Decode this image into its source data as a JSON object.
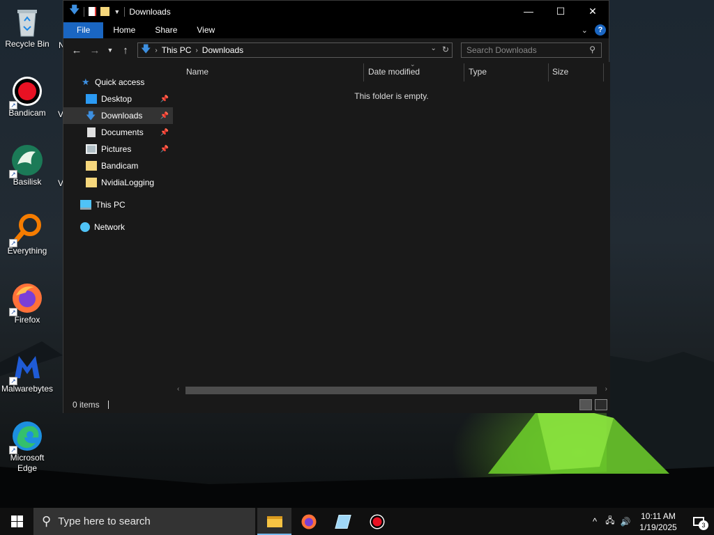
{
  "desktop": {
    "icons": [
      {
        "label": "Recycle Bin"
      },
      {
        "label": "Bandicam"
      },
      {
        "label": "Basilisk"
      },
      {
        "label": "Everything"
      },
      {
        "label": "Firefox"
      },
      {
        "label": "Malwarebytes"
      },
      {
        "label": "Microsoft Edge"
      }
    ],
    "partial_labels": [
      "N",
      "V",
      "V"
    ]
  },
  "window": {
    "title": "Downloads",
    "ribbon_tabs": [
      "File",
      "Home",
      "Share",
      "View"
    ],
    "help_label": "?",
    "address": {
      "crumbs": [
        "This PC",
        "Downloads"
      ],
      "search_placeholder": "Search Downloads"
    },
    "nav": {
      "quick_access": "Quick access",
      "pinned": [
        "Desktop",
        "Downloads",
        "Documents",
        "Pictures"
      ],
      "folders": [
        "Bandicam",
        "NvidiaLogging"
      ],
      "this_pc": "This PC",
      "network": "Network"
    },
    "columns": [
      "Name",
      "Date modified",
      "Type",
      "Size"
    ],
    "empty_message": "This folder is empty.",
    "status": "0 items"
  },
  "taskbar": {
    "search_placeholder": "Type here to search",
    "time": "10:11 AM",
    "date": "1/19/2025",
    "notification_count": "3"
  },
  "colors": {
    "accent": "#1a66c2",
    "window_bg": "#191919",
    "selection": "#333333"
  }
}
